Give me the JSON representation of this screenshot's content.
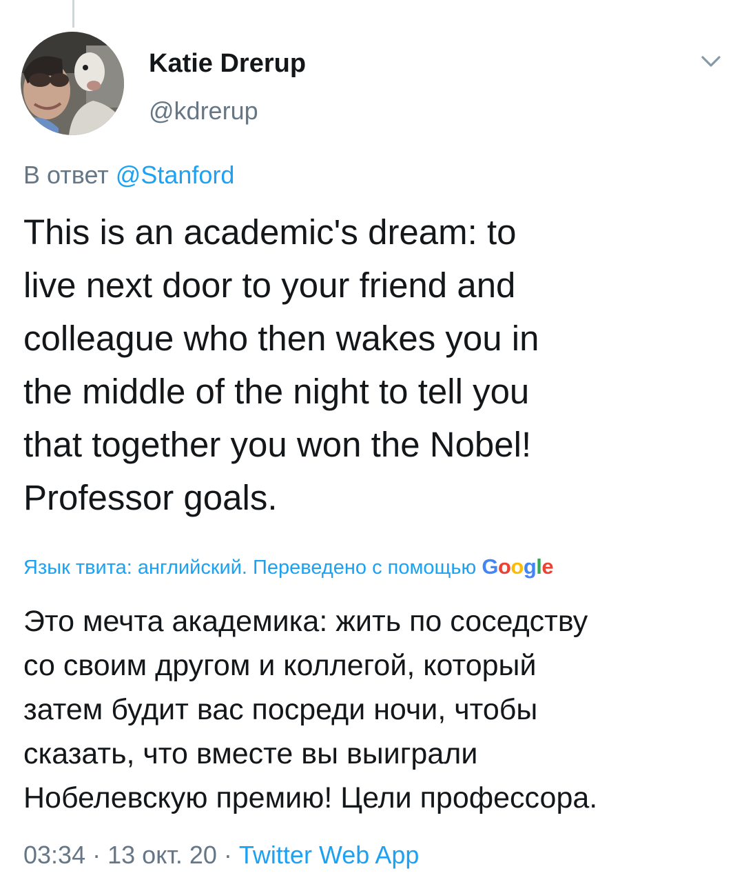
{
  "tweet": {
    "author_name": "Katie Drerup",
    "author_handle": "@kdrerup",
    "reply_prefix": "В ответ",
    "reply_mention": "@Stanford",
    "text": "This is an academic's dream: to\nlive next door to your friend and\ncolleague who then wakes you in\nthe middle of the night to tell you\nthat together you won the Nobel!\nProfessor goals.",
    "translation_note": "Язык твита: английский. Переведено с помощью",
    "translation_provider": "Google",
    "translated_text": "Это мечта академика: жить по соседству\nсо своим другом и коллегой, который\nзатем будит вас посреди ночи, чтобы\nсказать, что вместе вы выиграли\nНобелевскую премию! Цели профессора.",
    "time": "03:34",
    "separator": "·",
    "date": "13 окт. 20",
    "source": "Twitter Web App"
  },
  "icons": {
    "avatar": "avatar-photo",
    "menu": "chevron-down-icon"
  },
  "colors": {
    "link": "#1da1f2",
    "secondary_text": "#657786",
    "primary_text": "#14171a",
    "google_blue": "#4285f4",
    "google_red": "#ea4335",
    "google_yellow": "#fbbc05",
    "google_green": "#34a853"
  }
}
